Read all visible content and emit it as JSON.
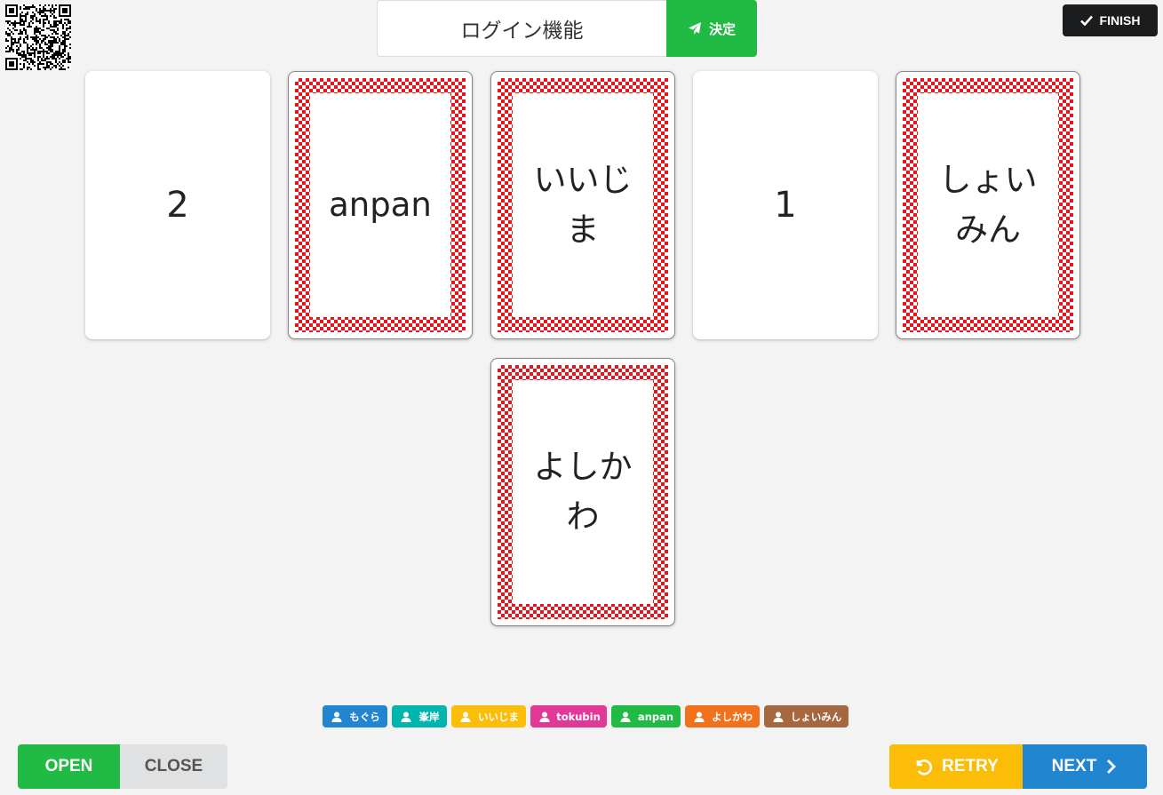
{
  "topic": {
    "text": "ログイン機能",
    "decide_label": "決定"
  },
  "finish_label": "FINISH",
  "cards": [
    {
      "text": "2",
      "face": "open"
    },
    {
      "text": "anpan",
      "face": "back"
    },
    {
      "text": "いいじま",
      "face": "back"
    },
    {
      "text": "1",
      "face": "open"
    },
    {
      "text": "しょいみん",
      "face": "back"
    },
    {
      "text": "よしかわ",
      "face": "back"
    }
  ],
  "participants": [
    {
      "name": "もぐら",
      "color": "#2185d0"
    },
    {
      "name": "峯岸",
      "color": "#00b5ad"
    },
    {
      "name": "いいじま",
      "color": "#fbbd08"
    },
    {
      "name": "tokubin",
      "color": "#e03997"
    },
    {
      "name": "anpan",
      "color": "#21ba45"
    },
    {
      "name": "よしかわ",
      "color": "#f2711c"
    },
    {
      "name": "しょいみん",
      "color": "#a5673f"
    }
  ],
  "controls": {
    "open_label": "OPEN",
    "close_label": "CLOSE",
    "retry_label": "RETRY",
    "next_label": "NEXT"
  },
  "icons": {
    "decide": "paper-plane-icon",
    "finish": "check-icon",
    "retry": "undo-icon",
    "next": "chevron-right-icon",
    "participant": "user-icon",
    "qr": "qr-code-icon"
  }
}
